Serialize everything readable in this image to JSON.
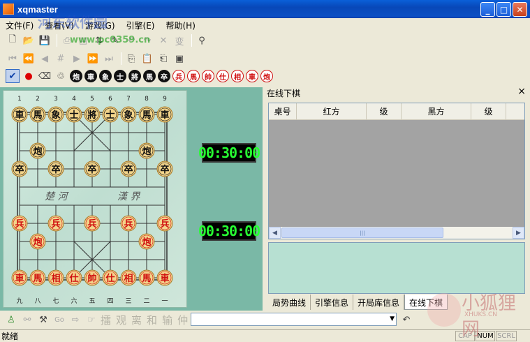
{
  "window": {
    "title": "xqmaster"
  },
  "menu": [
    "文件(F)",
    "查看(V)",
    "游戏(G)",
    "引擎(E)",
    "帮助(H)"
  ],
  "toolbar_pieces_black": [
    "炮",
    "車",
    "象",
    "士",
    "將",
    "馬",
    "卒"
  ],
  "toolbar_pieces_red": [
    "兵",
    "馬",
    "帥",
    "仕",
    "相",
    "車",
    "炮"
  ],
  "board": {
    "top_numbers": [
      "1",
      "2",
      "3",
      "4",
      "5",
      "6",
      "7",
      "8",
      "9"
    ],
    "bottom_numbers": [
      "九",
      "八",
      "七",
      "六",
      "五",
      "四",
      "三",
      "二",
      "一"
    ],
    "river_left": "楚 河",
    "river_right": "漢 界",
    "pieces": [
      {
        "t": "車",
        "s": "b",
        "c": 0,
        "r": 0
      },
      {
        "t": "馬",
        "s": "b",
        "c": 1,
        "r": 0
      },
      {
        "t": "象",
        "s": "b",
        "c": 2,
        "r": 0
      },
      {
        "t": "士",
        "s": "b",
        "c": 3,
        "r": 0
      },
      {
        "t": "將",
        "s": "b",
        "c": 4,
        "r": 0
      },
      {
        "t": "士",
        "s": "b",
        "c": 5,
        "r": 0
      },
      {
        "t": "象",
        "s": "b",
        "c": 6,
        "r": 0
      },
      {
        "t": "馬",
        "s": "b",
        "c": 7,
        "r": 0
      },
      {
        "t": "車",
        "s": "b",
        "c": 8,
        "r": 0
      },
      {
        "t": "炮",
        "s": "b",
        "c": 1,
        "r": 2
      },
      {
        "t": "炮",
        "s": "b",
        "c": 7,
        "r": 2
      },
      {
        "t": "卒",
        "s": "b",
        "c": 0,
        "r": 3
      },
      {
        "t": "卒",
        "s": "b",
        "c": 2,
        "r": 3
      },
      {
        "t": "卒",
        "s": "b",
        "c": 4,
        "r": 3
      },
      {
        "t": "卒",
        "s": "b",
        "c": 6,
        "r": 3
      },
      {
        "t": "卒",
        "s": "b",
        "c": 8,
        "r": 3
      },
      {
        "t": "兵",
        "s": "r",
        "c": 0,
        "r": 6
      },
      {
        "t": "兵",
        "s": "r",
        "c": 2,
        "r": 6
      },
      {
        "t": "兵",
        "s": "r",
        "c": 4,
        "r": 6
      },
      {
        "t": "兵",
        "s": "r",
        "c": 6,
        "r": 6
      },
      {
        "t": "兵",
        "s": "r",
        "c": 8,
        "r": 6
      },
      {
        "t": "炮",
        "s": "r",
        "c": 1,
        "r": 7
      },
      {
        "t": "炮",
        "s": "r",
        "c": 7,
        "r": 7
      },
      {
        "t": "車",
        "s": "r",
        "c": 0,
        "r": 9
      },
      {
        "t": "馬",
        "s": "r",
        "c": 1,
        "r": 9
      },
      {
        "t": "相",
        "s": "r",
        "c": 2,
        "r": 9
      },
      {
        "t": "仕",
        "s": "r",
        "c": 3,
        "r": 9
      },
      {
        "t": "帥",
        "s": "r",
        "c": 4,
        "r": 9
      },
      {
        "t": "仕",
        "s": "r",
        "c": 5,
        "r": 9
      },
      {
        "t": "相",
        "s": "r",
        "c": 6,
        "r": 9
      },
      {
        "t": "馬",
        "s": "r",
        "c": 7,
        "r": 9
      },
      {
        "t": "車",
        "s": "r",
        "c": 8,
        "r": 9
      }
    ]
  },
  "clocks": {
    "top": "00:30:00",
    "bottom": "00:30:00"
  },
  "online_panel": {
    "title": "在线下棋",
    "close": "×",
    "columns": [
      "桌号",
      "红方",
      "级",
      "黑方",
      "级"
    ]
  },
  "tabs": [
    "局势曲线",
    "引擎信息",
    "开局库信息",
    "在线下棋"
  ],
  "bottom_toolbar": {
    "go_label": "Go",
    "actions": [
      "擂",
      "观",
      "离",
      "和",
      "输",
      "仲"
    ],
    "combo_value": ""
  },
  "status": {
    "text": "就绪",
    "cap": "CAP",
    "num": "NUM",
    "scrl": "SCRL"
  },
  "watermarks": {
    "site_name": "河东软件园",
    "site_url": "www.pc0359.cn",
    "brand_cn": "小狐狸网",
    "brand_en": "XHUKS.CN"
  },
  "colors": {
    "clock_digits": "#27ff32",
    "red_piece": "#d01010",
    "board_bg": "#cfe6da"
  }
}
